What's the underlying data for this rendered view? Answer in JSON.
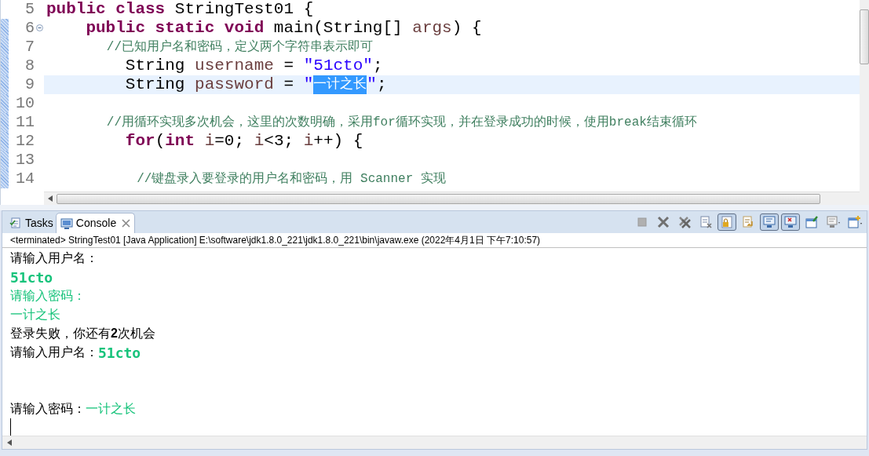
{
  "editor": {
    "lines": [
      {
        "number": "5",
        "marked": false,
        "current": false,
        "foldable": false,
        "tokens": [
          {
            "t": "public class",
            "kind": "keyword"
          },
          {
            "t": " StringTest01 {",
            "kind": "plain"
          }
        ]
      },
      {
        "number": "6",
        "marked": true,
        "current": false,
        "foldable": true,
        "tokens": [
          {
            "t": "    public static void",
            "kind": "keyword"
          },
          {
            "t": " main(String[] ",
            "kind": "plain"
          },
          {
            "t": "args",
            "kind": "variable"
          },
          {
            "t": ") {",
            "kind": "plain"
          }
        ]
      },
      {
        "number": "7",
        "marked": true,
        "current": false,
        "foldable": false,
        "tokens": [
          {
            "t": "        //已知用户名和密码，定义两个字符串表示即可",
            "kind": "comment"
          }
        ]
      },
      {
        "number": "8",
        "marked": true,
        "current": false,
        "foldable": false,
        "tokens": [
          {
            "t": "        String ",
            "kind": "plain"
          },
          {
            "t": "username",
            "kind": "variable"
          },
          {
            "t": " = ",
            "kind": "plain"
          },
          {
            "t": "\"51cto\"",
            "kind": "string"
          },
          {
            "t": ";",
            "kind": "plain"
          }
        ]
      },
      {
        "number": "9",
        "marked": true,
        "current": true,
        "foldable": false,
        "tokens": [
          {
            "t": "        String ",
            "kind": "plain"
          },
          {
            "t": "password",
            "kind": "variable"
          },
          {
            "t": " = ",
            "kind": "plain"
          },
          {
            "t": "\"",
            "kind": "string"
          },
          {
            "t": "一计之长",
            "kind": "selection"
          },
          {
            "t": "\"",
            "kind": "string"
          },
          {
            "t": ";",
            "kind": "plain"
          }
        ]
      },
      {
        "number": "10",
        "marked": true,
        "current": false,
        "foldable": false
      },
      {
        "number": "11",
        "marked": true,
        "current": false,
        "foldable": false,
        "tokens": [
          {
            "t": "        //用循环实现多次机会，这里的次数明确，采用for循环实现，并在登录成功的时候，使用break结束循环",
            "kind": "comment"
          }
        ]
      },
      {
        "number": "12",
        "marked": true,
        "current": false,
        "foldable": false,
        "tokens": [
          {
            "t": "        for",
            "kind": "keyword"
          },
          {
            "t": "(",
            "kind": "plain"
          },
          {
            "t": "int ",
            "kind": "keyword"
          },
          {
            "t": "i",
            "kind": "variable"
          },
          {
            "t": "=0; ",
            "kind": "plain"
          },
          {
            "t": "i",
            "kind": "variable"
          },
          {
            "t": "<3; ",
            "kind": "plain"
          },
          {
            "t": "i",
            "kind": "variable"
          },
          {
            "t": "++) {",
            "kind": "plain"
          }
        ]
      },
      {
        "number": "13",
        "marked": true,
        "current": false,
        "foldable": false
      },
      {
        "number": "14",
        "marked": true,
        "current": false,
        "foldable": false,
        "tokens": [
          {
            "t": "            //键盘录入要登录的用户名和密码，用 Scanner 实现",
            "kind": "comment"
          }
        ]
      }
    ]
  },
  "panel": {
    "tabs": [
      {
        "label": "Tasks",
        "kind": "tasks",
        "selected": false,
        "closable": false
      },
      {
        "label": "Console",
        "kind": "console",
        "selected": true,
        "closable": true
      }
    ],
    "toolbar": [
      {
        "kind": "stop",
        "on": false
      },
      {
        "kind": "remove",
        "on": false
      },
      {
        "kind": "remove-all",
        "on": false
      },
      {
        "kind": "clear",
        "on": false
      },
      {
        "kind": "scroll-lock",
        "on": true
      },
      {
        "kind": "word-wrap",
        "on": false
      },
      {
        "kind": "show-out",
        "on": true
      },
      {
        "kind": "show-err",
        "on": true
      },
      {
        "kind": "pin",
        "on": false
      },
      {
        "kind": "display",
        "on": false
      },
      {
        "kind": "new-console",
        "on": false
      }
    ],
    "description": "<terminated> StringTest01 [Java Application] E:\\software\\jdk1.8.0_221\\jdk1.8.0_221\\bin\\javaw.exe (2022年4月1日 下午7:10:57)",
    "console_lines": [
      {
        "kind": "text",
        "segments": [
          {
            "t": "请输入用户名：",
            "kind": "output"
          }
        ]
      },
      {
        "kind": "text",
        "segments": [
          {
            "t": "51cto",
            "kind": "input-code"
          }
        ]
      },
      {
        "kind": "text",
        "segments": [
          {
            "t": "请输入密码：",
            "kind": "input"
          }
        ]
      },
      {
        "kind": "text",
        "segments": [
          {
            "t": "一计之长",
            "kind": "input"
          }
        ]
      },
      {
        "kind": "text",
        "segments": [
          {
            "t": "登录失败，你还有**2**次机会",
            "kind": "output"
          }
        ]
      },
      {
        "kind": "text",
        "segments": [
          {
            "t": "请输入用户名：",
            "kind": "output"
          },
          {
            "t": "51cto",
            "kind": "input-code"
          }
        ]
      },
      {
        "kind": "blank"
      },
      {
        "kind": "blank"
      },
      {
        "kind": "text",
        "segments": [
          {
            "t": "请输入密码：",
            "kind": "output"
          },
          {
            "t": "一计之长",
            "kind": "input"
          }
        ]
      }
    ]
  }
}
